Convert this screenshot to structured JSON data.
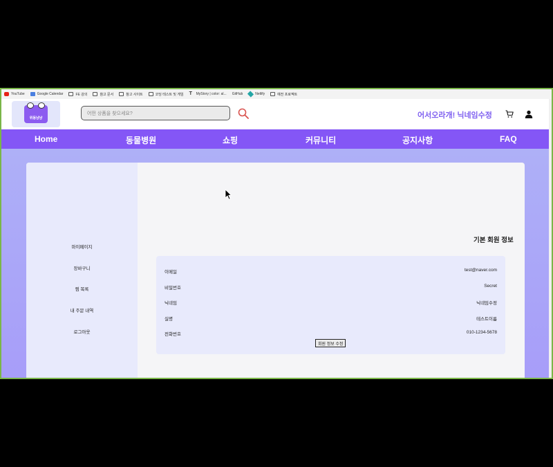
{
  "bookmarks": [
    {
      "label": "YouTube",
      "icon": "youtube-icon"
    },
    {
      "label": "Google Calendar",
      "icon": "calendar-icon"
    },
    {
      "label": "FE 강의",
      "icon": "folder-icon"
    },
    {
      "label": "참고 문서",
      "icon": "folder-icon"
    },
    {
      "label": "참고 사이트",
      "icon": "folder-icon"
    },
    {
      "label": "코딩 테스트 및 게임",
      "icon": "folder-icon"
    },
    {
      "label": "MyStory | color: al...",
      "icon": "typography-icon"
    },
    {
      "label": "GitHub",
      "icon": "none"
    },
    {
      "label": "Netlify",
      "icon": "netlify-icon"
    },
    {
      "label": "예전 프로젝트",
      "icon": "folder-icon"
    }
  ],
  "header": {
    "logo_text": "위동냥냥",
    "search_placeholder": "어떤 상품을 찾으세요?",
    "greeting": "어서오라개! 닉네임수정"
  },
  "nav": {
    "items": [
      "Home",
      "동물병원",
      "쇼핑",
      "커뮤니티",
      "공지사항",
      "FAQ"
    ]
  },
  "sidebar": {
    "items": [
      "마이페이지",
      "장바구니",
      "찜 목록",
      "내 주문 내역",
      "로그아웃"
    ]
  },
  "profile": {
    "title": "기본 회원 정보",
    "rows": [
      {
        "label": "이메일",
        "value": "test@naver.com"
      },
      {
        "label": "비밀번호",
        "value": "Secret"
      },
      {
        "label": "닉네임",
        "value": "닉네임수정"
      },
      {
        "label": "실명",
        "value": "테스트이름"
      },
      {
        "label": "전화번호",
        "value": "010-1234-5678"
      }
    ],
    "edit_button": "회원 정보 수정"
  },
  "colors": {
    "accent": "#8456f6",
    "greeting": "#7e5ff0",
    "background_gradient_top": "#aeb0f7",
    "background_gradient_bottom": "#a79df9"
  }
}
